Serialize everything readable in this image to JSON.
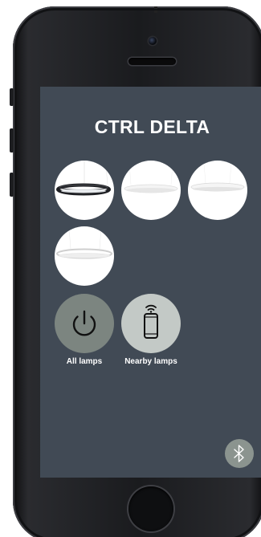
{
  "app": {
    "title": "CTRL DELTA"
  },
  "lamps": [
    {
      "id": "lamp-1",
      "style": "dark-ring"
    },
    {
      "id": "lamp-2",
      "style": "white-disc"
    },
    {
      "id": "lamp-3",
      "style": "white-disc"
    },
    {
      "id": "lamp-4",
      "style": "white-ring"
    }
  ],
  "controls": {
    "all_lamps_label": "All lamps",
    "nearby_lamps_label": "Nearby lamps"
  },
  "icons": {
    "power": "power-icon",
    "nearby": "smartphone-signal-icon",
    "bluetooth": "bluetooth-icon"
  },
  "colors": {
    "screen_background": "#414a55",
    "lamp_tile": "#ffffff",
    "all_lamps_button": "#7c8580",
    "nearby_lamps_button": "#c3c9c6",
    "bluetooth_button": "#8b948f"
  }
}
